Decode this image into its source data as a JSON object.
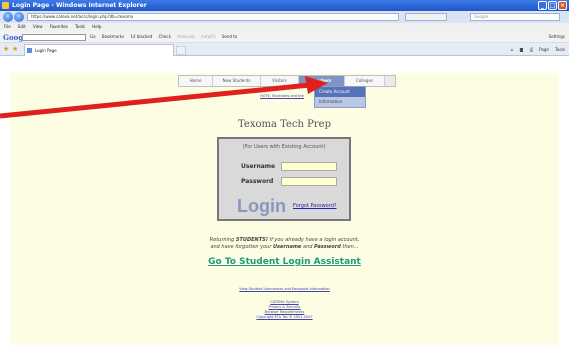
{
  "window": {
    "title": "Login Page - Windows Internet Explorer",
    "buttons": [
      "_",
      "□",
      "×"
    ]
  },
  "address_bar": {
    "url": "https://www.catexa.net/accs/login.php?db=texoma",
    "search_placeholder": "Google"
  },
  "menu": [
    "File",
    "Edit",
    "View",
    "Favorites",
    "Tools",
    "Help"
  ],
  "google_toolbar": {
    "logo": "Google",
    "items": [
      "Go",
      "Bookmarks",
      "14 blocked",
      "Check",
      "AutoLink",
      "AutoFill",
      "Send to"
    ],
    "settings": "Settings"
  },
  "tab": {
    "label": "Login Page"
  },
  "command_bar": [
    "Page",
    "Tools"
  ],
  "site_nav": {
    "items": [
      "Home",
      "New Students",
      "Visitors",
      "Teachers",
      "Colleges"
    ],
    "active_index": 3
  },
  "dropdown": {
    "items": [
      "Create Account",
      "Information"
    ],
    "highlighted_index": 0
  },
  "sublinks": "HOTE, Illustrates and the",
  "site_title": "Texoma Tech Prep",
  "login_box": {
    "note": "(For Users with Existing Account)",
    "username_label": "Username",
    "password_label": "Password",
    "login_word": "Login",
    "forgot_link": "Forgot Password?"
  },
  "returning": {
    "line1_prefix": "Returning ",
    "line1_bold": "STUDENTS!",
    "line1_suffix": " If you already have a login account,",
    "line2_prefix": "and have forgotten your ",
    "line2_bold1": "Username",
    "line2_mid": " and ",
    "line2_bold2": "Password",
    "line2_suffix": " then..."
  },
  "assistant_link": "Go To Student Login Assistant",
  "view_info_link": "View Student Usernames and Password Information",
  "footer_links": [
    "CATEMA System",
    "Privacy & Security",
    "Browser Requirements",
    "Copyright ETA Tec ® 2001-2007"
  ],
  "colors": {
    "arrow": "#e0201c",
    "nav_active": "#7f94c4",
    "assistant": "#1f9a7a",
    "page_bg": "#fcfde3"
  }
}
